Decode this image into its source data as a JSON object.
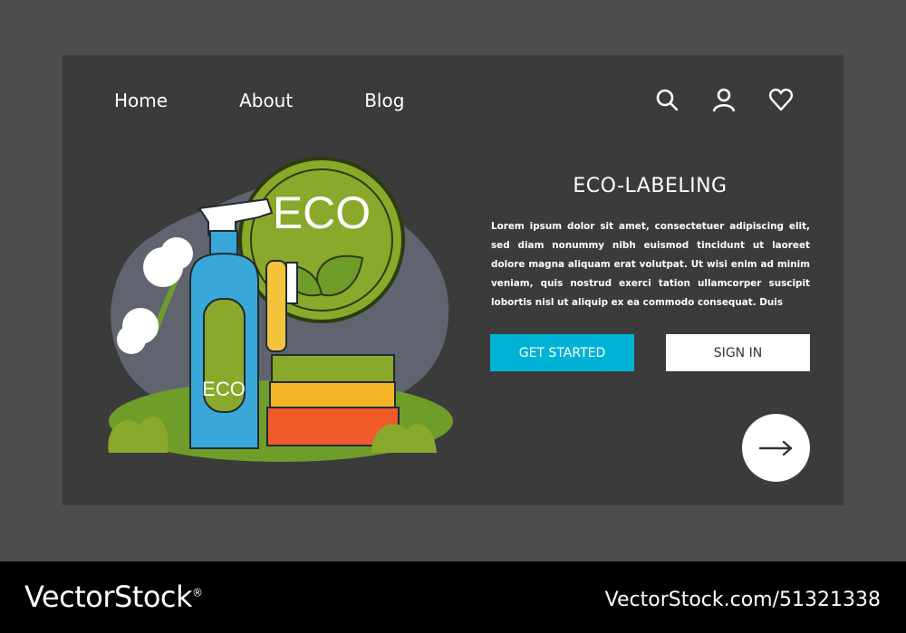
{
  "nav": {
    "items": [
      "Home",
      "About",
      "Blog"
    ]
  },
  "header_icons": [
    "search-icon",
    "user-icon",
    "heart-icon"
  ],
  "hero": {
    "title": "ECO-LABELING",
    "body": "Lorem ipsum dolor sit amet, consectetuer adipiscing elit, sed diam nonummy nibh euismod tincidunt ut laoreet dolore magna aliquam erat volutpat. Ut wisi enim ad minim veniam, quis nostrud exerci tation ullamcorper suscipit lobortis nisl ut aliquip ex ea commodo consequat. Duis",
    "primary_button": "GET STARTED",
    "secondary_button": "SIGN IN",
    "next_icon": "arrow-right-icon"
  },
  "illustration": {
    "badge_text": "ECO",
    "bottle_label": "ECO"
  },
  "watermark": {
    "logo": "VectorStock",
    "logo_mark": "®",
    "url": "VectorStock.com/51321338"
  },
  "colors": {
    "page_bg": "#3b3b3b",
    "frame_bg": "#4d4d4d",
    "primary": "#00b3d6",
    "eco_green": "#8aa82a",
    "bottle_blue": "#3aa7d9"
  }
}
